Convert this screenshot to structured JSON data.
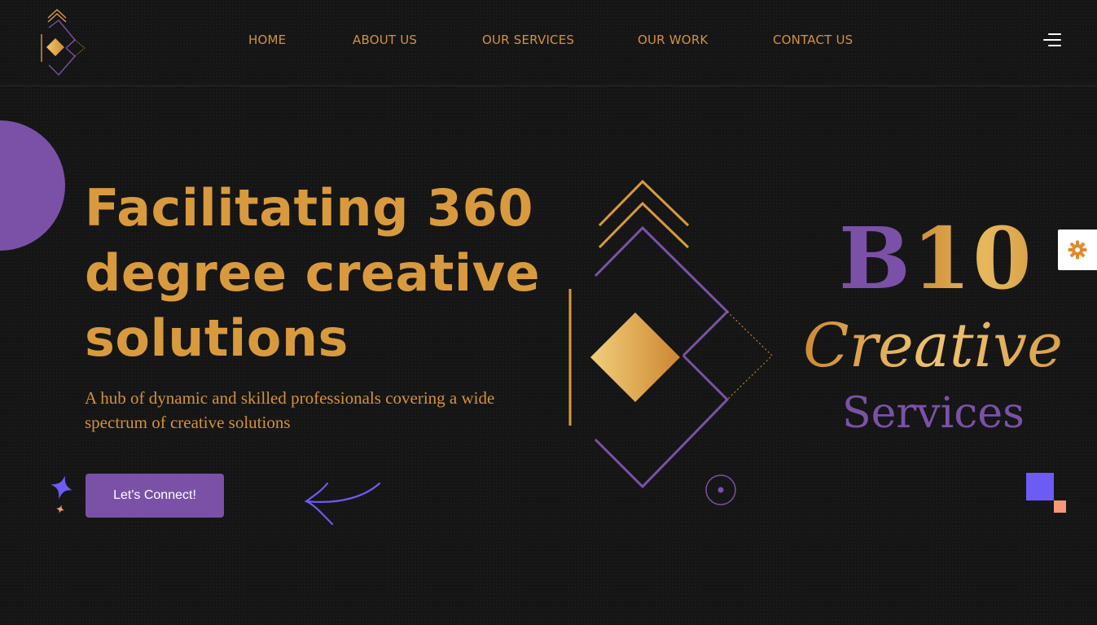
{
  "nav": {
    "items": [
      {
        "label": "HOME"
      },
      {
        "label": "ABOUT US"
      },
      {
        "label": "OUR SERVICES"
      },
      {
        "label": "OUR WORK"
      },
      {
        "label": "CONTACT US"
      }
    ],
    "menu_icon": "hamburger-menu-icon"
  },
  "hero": {
    "title": "Facilitating 360 degree creative solutions",
    "subtitle": "A hub of dynamic and skilled professionals covering a wide spectrum of creative solutions",
    "cta_label": "Let's Connect!"
  },
  "brand": {
    "b": "B",
    "num": "10",
    "creative": "Creative",
    "services": "Services"
  },
  "colors": {
    "gold": "#d99a3e",
    "purple": "#7b51a8",
    "background": "#151515",
    "violet": "#6c5cf5",
    "salmon": "#f4977a"
  },
  "icons": {
    "logo": "b10-diamond-logo-icon",
    "settings": "gear-icon",
    "sparkle": "sparkle-star-icon",
    "arrow": "curved-arrow-icon"
  }
}
